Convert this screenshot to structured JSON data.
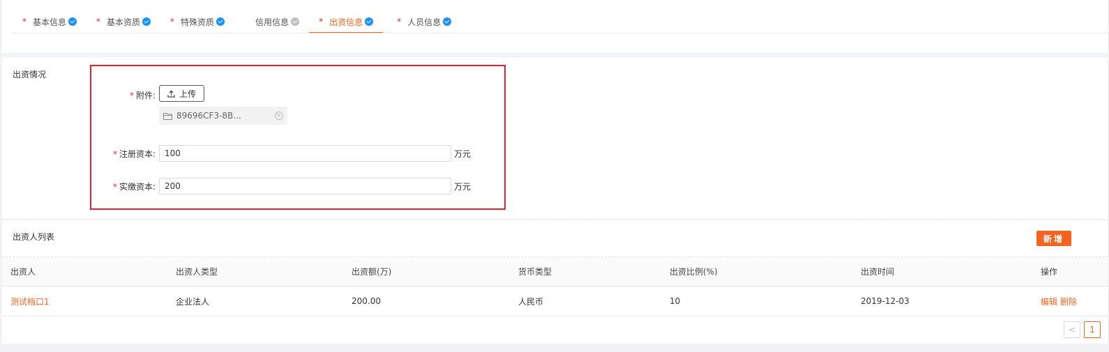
{
  "tabs": [
    {
      "label": "基本信息",
      "required": "*",
      "status": "done"
    },
    {
      "label": "基本资质",
      "required": "*",
      "status": "done"
    },
    {
      "label": "特殊资质",
      "required": "*",
      "status": "done"
    },
    {
      "label": "信用信息",
      "required": "",
      "status": "pending"
    },
    {
      "label": "出资信息",
      "required": "*",
      "status": "done",
      "active": true
    },
    {
      "label": "人员信息",
      "required": "*",
      "status": "done"
    }
  ],
  "capital": {
    "section_title": "出资情况",
    "attachment_label": "附件:",
    "upload_label": "上传",
    "file_name": "89696CF3-8B...",
    "registered_label": "注册资本:",
    "registered_value": "100",
    "registered_unit": "万元",
    "paid_label": "实缴资本:",
    "paid_value": "200",
    "paid_unit": "万元",
    "required_mark": "*"
  },
  "investors": {
    "section_title": "出资人列表",
    "add_label": "新增",
    "columns": [
      "出资人",
      "出资人类型",
      "出资额(万)",
      "货币类型",
      "出资比例(%)",
      "出资时间",
      "操作"
    ],
    "rows": [
      {
        "name": "测试档口1",
        "type": "企业法人",
        "amount": "200.00",
        "currency": "人民币",
        "ratio": "10",
        "date": "2019-12-03",
        "edit": "编辑",
        "delete": "删除"
      }
    ],
    "pagination": {
      "prev": "<",
      "current": "1"
    }
  },
  "colors": {
    "accent": "#f5641e",
    "check": "#1890ff",
    "required": "#f5222d",
    "highlight": "#e5222d"
  }
}
